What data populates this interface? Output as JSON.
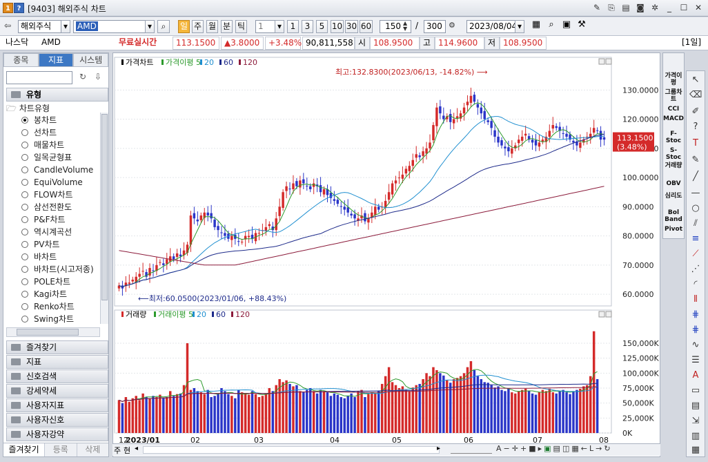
{
  "window": {
    "badge": "1",
    "help": "?",
    "title": "[9403] 해외주식 차트"
  },
  "toolbar": {
    "market": "해외주식",
    "symbol": "AMD",
    "period_buttons": [
      "일",
      "주",
      "월",
      "분",
      "틱"
    ],
    "interval_value": "1",
    "interval_buttons": [
      "1",
      "3",
      "5",
      "10",
      "30",
      "60"
    ],
    "count": "150",
    "count_sep": "/",
    "total": "300",
    "date": "2023/08/04"
  },
  "quote": {
    "exchange": "나스닥",
    "ticker": "AMD",
    "realtime_label": "무료실시간",
    "price": "113.1500",
    "change": "▲3.8000",
    "change_pct": "+3.48%",
    "volume": "90,811,558",
    "open_label": "시",
    "open": "108.9500",
    "high_label": "고",
    "high": "114.9600",
    "low_label": "저",
    "low": "108.9500",
    "period_label": "[1일]"
  },
  "left": {
    "tabs": [
      "종목",
      "지표",
      "시스템"
    ],
    "type_header": "유형",
    "tree_root": "차트유형",
    "chart_types": [
      "봉차트",
      "선차트",
      "매물차트",
      "일목균형표",
      "CandleVolume",
      "EquiVolume",
      "FLOW차트",
      "삼선전환도",
      "P&F차트",
      "역시계곡선",
      "PV차트",
      "바차트",
      "바차트(시고저종)",
      "POLE차트",
      "Kagi차트",
      "Renko차트",
      "Swing차트"
    ],
    "selected_type": "봉차트",
    "sections": [
      "즐겨찾기",
      "지표",
      "신호검색",
      "강세약세",
      "사용자지표",
      "사용자신호",
      "사용자강약"
    ],
    "bottom_tabs": [
      "즐겨찾기",
      "등록",
      "삭제"
    ]
  },
  "chart_data": {
    "type": "candlestick",
    "price_pane": {
      "legend": [
        "가격차트",
        "가격이평 5",
        "20",
        "60",
        "120"
      ],
      "legend_colors": [
        "#000000",
        "#2c9a2c",
        "#1f8fd0",
        "#1d2a8a",
        "#8b1a3a"
      ],
      "yticks": [
        130,
        120,
        110,
        100,
        90,
        80,
        70,
        60
      ],
      "ytick_labels": [
        "130.0000",
        "120.0000",
        "110.0000",
        "100.0000",
        "90.0000",
        "80.0000",
        "70.0000",
        "60.0000"
      ],
      "ylim": [
        56,
        136
      ],
      "last_price_tag": "113.1500",
      "last_pct_tag": "(3.48%)",
      "max_annotation": "최고:132.8300(2023/06/13, -14.82%)",
      "min_annotation": "최저:60.0500(2023/01/06, +88.43%)",
      "up_color": "#d42a2a",
      "down_color": "#2a35c8"
    },
    "volume_pane": {
      "legend": [
        "거래량",
        "거래이평 5",
        "20",
        "60",
        "120"
      ],
      "legend_colors": [
        "#d42a2a",
        "#2c9a2c",
        "#1f8fd0",
        "#1d2a8a",
        "#8b1a3a"
      ],
      "yticks": [
        150000,
        125000,
        100000,
        75000,
        50000,
        25000,
        0
      ],
      "ytick_labels": [
        "150,000K",
        "125,000K",
        "100,000K",
        "75,000K",
        "50,000K",
        "25,000K",
        "0K"
      ],
      "ylim": [
        0,
        180000
      ]
    },
    "x_labels": [
      "12",
      "2023/01",
      "02",
      "03",
      "04",
      "05",
      "06",
      "07",
      "08"
    ],
    "closes": [
      63,
      62,
      64,
      64,
      65,
      66,
      67,
      68,
      66,
      69,
      68,
      70,
      71,
      70,
      72,
      73,
      72,
      74,
      73,
      75,
      77,
      87,
      86,
      85,
      87,
      88,
      87,
      86,
      83,
      82,
      81,
      80,
      79,
      80,
      79,
      78,
      78,
      80,
      80,
      79,
      81,
      81,
      82,
      83,
      84,
      82,
      86,
      90,
      95,
      97,
      96,
      98,
      97,
      99,
      98,
      97,
      96,
      98,
      97,
      95,
      96,
      94,
      93,
      92,
      91,
      90,
      89,
      88,
      87,
      86,
      86,
      87,
      85,
      86,
      88,
      90,
      89,
      90,
      92,
      95,
      98,
      99,
      100,
      101,
      103,
      104,
      106,
      108,
      107,
      109,
      110,
      112,
      118,
      124,
      122,
      120,
      121,
      119,
      120,
      121,
      122,
      124,
      126,
      128,
      126,
      124,
      122,
      120,
      119,
      117,
      114,
      112,
      111,
      110,
      109,
      110,
      111,
      113,
      114,
      115,
      113,
      112,
      111,
      112,
      113,
      114,
      116,
      118,
      117,
      116,
      115,
      114,
      113,
      112,
      111,
      112,
      113,
      114,
      115,
      117,
      116,
      113,
      113
    ],
    "volumes": [
      55,
      50,
      60,
      52,
      58,
      62,
      55,
      66,
      60,
      58,
      62,
      60,
      64,
      58,
      60,
      70,
      62,
      65,
      66,
      80,
      150,
      72,
      75,
      70,
      68,
      65,
      72,
      60,
      62,
      66,
      75,
      70,
      65,
      62,
      58,
      72,
      68,
      66,
      64,
      70,
      65,
      60,
      62,
      66,
      75,
      70,
      80,
      90,
      85,
      88,
      82,
      78,
      80,
      70,
      68,
      72,
      75,
      70,
      66,
      72,
      70,
      68,
      62,
      66,
      64,
      60,
      58,
      62,
      66,
      60,
      70,
      72,
      60,
      65,
      68,
      66,
      70,
      82,
      95,
      110,
      85,
      80,
      75,
      78,
      72,
      70,
      76,
      80,
      82,
      90,
      100,
      95,
      110,
      105,
      100,
      96,
      88,
      84,
      90,
      92,
      95,
      100,
      110,
      120,
      105,
      95,
      90,
      85,
      84,
      80,
      76,
      78,
      72,
      70,
      74,
      68,
      66,
      70,
      72,
      74,
      70,
      66,
      64,
      68,
      72,
      70,
      74,
      68,
      66,
      70,
      72,
      68,
      65,
      70,
      72,
      74,
      78,
      80,
      95,
      170,
      90
    ]
  },
  "bottom": {
    "label": "주",
    "label2": "현"
  },
  "right_indicators": [
    "가격이평",
    "그룹차트",
    "CCI",
    "MACD",
    "F-Stoc",
    "S-Stoc",
    "거래량",
    "OBV",
    "심리도",
    "Bol Band",
    "Pivot"
  ]
}
